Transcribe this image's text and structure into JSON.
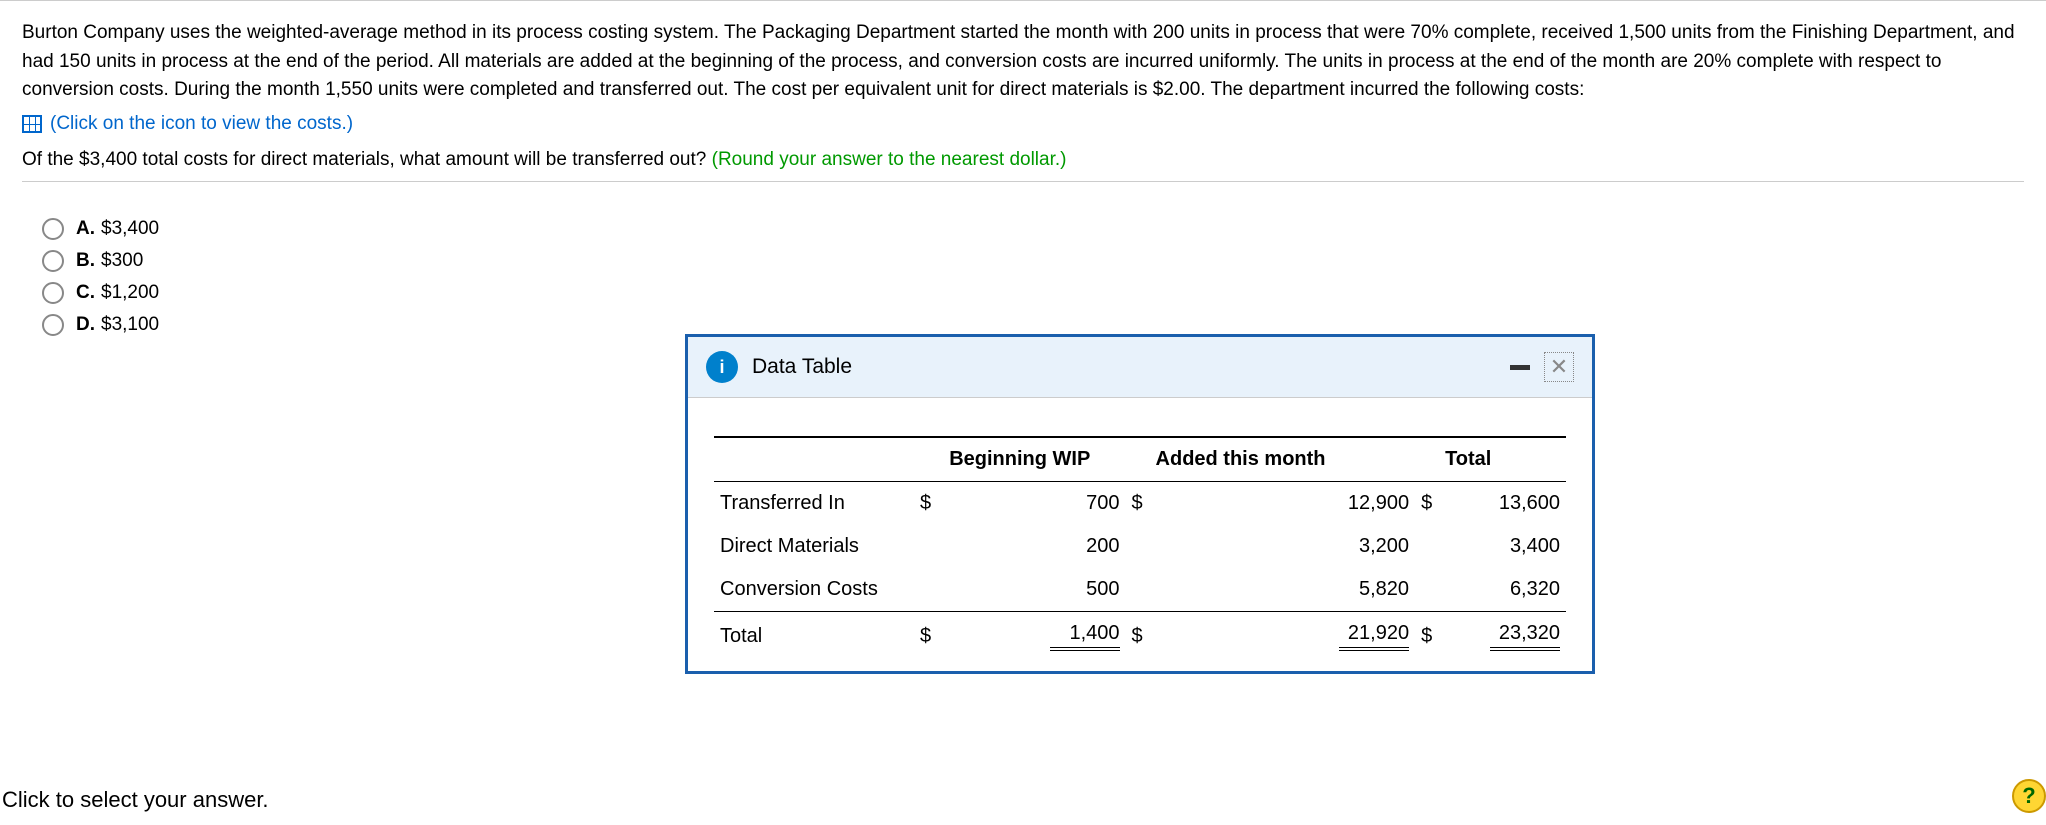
{
  "question": {
    "main": "Burton Company uses the weighted-average method in its process costing system. The Packaging Department started the month with 200 units in process that were 70% complete, received 1,500 units from the Finishing Department, and had 150 units in process at the end of the period. All materials are added at the beginning of the process, and conversion costs are incurred uniformly. The units in process at the end of the month are 20% complete with respect to conversion costs. During the month 1,550 units were completed and transferred out. The cost per equivalent unit for direct materials is $2.00. The department incurred the following costs:",
    "view_costs_link": "(Click on the icon to view the costs.)",
    "sub_question_prefix": "Of the $3,400 total costs for direct materials, what amount will be transferred out? ",
    "sub_question_hint": "(Round your answer to the nearest dollar.)"
  },
  "options": [
    {
      "letter": "A.",
      "text": "$3,400"
    },
    {
      "letter": "B.",
      "text": "$300"
    },
    {
      "letter": "C.",
      "text": "$1,200"
    },
    {
      "letter": "D.",
      "text": "$3,100"
    }
  ],
  "footer": "Click to select your answer.",
  "popup": {
    "title": "Data Table",
    "info_glyph": "i",
    "close_glyph": "✕",
    "headers": {
      "c0": "",
      "c1": "Beginning WIP",
      "c2": "Added this month",
      "c3": "Total"
    },
    "rows": [
      {
        "label": "Transferred In",
        "d1": "$",
        "v1": "700",
        "d2": "$",
        "v2": "12,900",
        "d3": "$",
        "v3": "13,600"
      },
      {
        "label": "Direct Materials",
        "d1": "",
        "v1": "200",
        "d2": "",
        "v2": "3,200",
        "d3": "",
        "v3": "3,400"
      },
      {
        "label": "Conversion Costs",
        "d1": "",
        "v1": "500",
        "d2": "",
        "v2": "5,820",
        "d3": "",
        "v3": "6,320"
      }
    ],
    "total": {
      "label": "Total",
      "d1": "$",
      "v1": "1,400",
      "d2": "$",
      "v2": "21,920",
      "d3": "$",
      "v3": "23,320"
    }
  },
  "help_glyph": "?"
}
